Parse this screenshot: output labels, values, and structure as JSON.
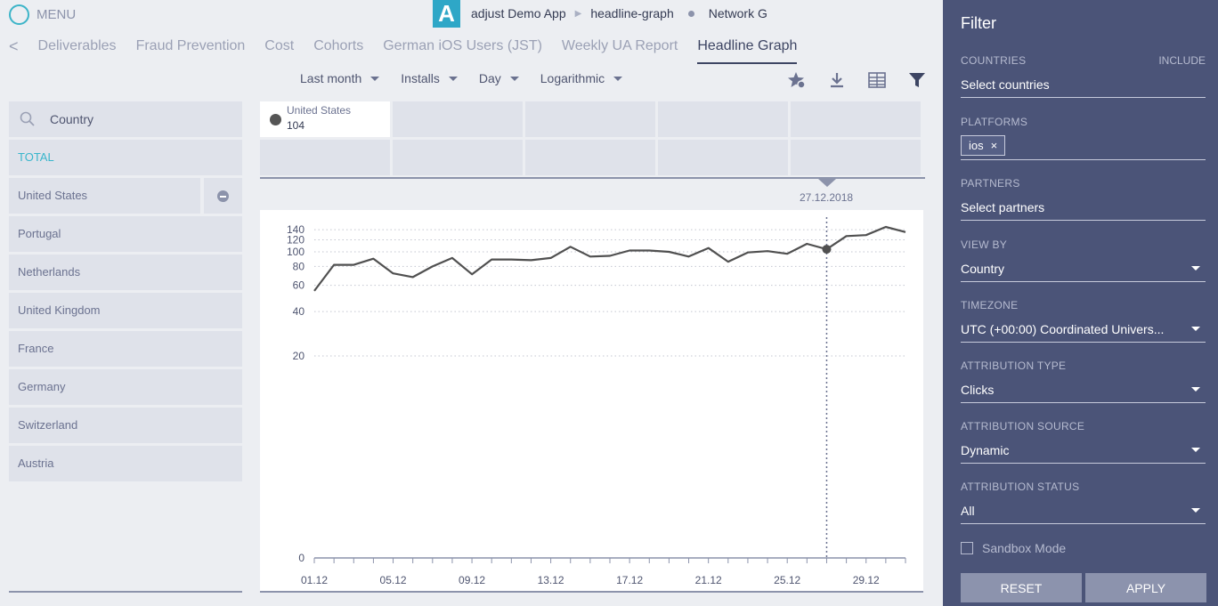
{
  "header": {
    "menu_label": "MENU",
    "app_name": "adjust Demo App",
    "breadcrumb_1": "headline-graph",
    "breadcrumb_2": "Network G",
    "app_logo_letter": "A"
  },
  "tabs": [
    "Deliverables",
    "Fraud Prevention",
    "Cost",
    "Cohorts",
    "German iOS Users (JST)",
    "Weekly UA Report",
    "Headline Graph"
  ],
  "active_tab": "Headline Graph",
  "toolbar": {
    "period": "Last month",
    "metric": "Installs",
    "granularity": "Day",
    "scale": "Logarithmic",
    "icons": [
      "favorite-icon",
      "download-icon",
      "table-icon",
      "filter-icon"
    ]
  },
  "left_panel": {
    "search_placeholder": "Country",
    "total_label": "TOTAL",
    "countries": [
      "United States",
      "Portugal",
      "Netherlands",
      "United Kingdom",
      "France",
      "Germany",
      "Switzerland",
      "Austria"
    ]
  },
  "legend": {
    "selected_name": "United States",
    "selected_value": "104",
    "hover_date": "27.12.2018"
  },
  "chart_data": {
    "type": "line",
    "scale": "log",
    "y_ticks": [
      0,
      20,
      40,
      60,
      80,
      100,
      120,
      140
    ],
    "x_tick_labels": [
      "01.12",
      "05.12",
      "09.12",
      "13.12",
      "17.12",
      "21.12",
      "25.12",
      "29.12"
    ],
    "series": [
      {
        "name": "United States",
        "color": "#505050",
        "values": [
          55,
          82,
          82,
          90,
          72,
          68,
          80,
          91,
          71,
          89,
          89,
          88,
          91,
          108,
          93,
          94,
          102,
          102,
          100,
          93,
          106,
          86,
          99,
          101,
          97,
          113,
          104,
          127,
          129,
          146,
          135
        ]
      }
    ],
    "highlight_index": 26
  },
  "filter": {
    "title": "Filter",
    "countries_label": "COUNTRIES",
    "include_label": "INCLUDE",
    "countries_placeholder": "Select countries",
    "platforms_label": "PLATFORMS",
    "platform_chip": "ios",
    "chip_remove": "×",
    "partners_label": "PARTNERS",
    "partners_placeholder": "Select partners",
    "view_by_label": "VIEW BY",
    "view_by_value": "Country",
    "timezone_label": "TIMEZONE",
    "timezone_value": "UTC (+00:00) Coordinated Univers...",
    "attr_type_label": "ATTRIBUTION TYPE",
    "attr_type_value": "Clicks",
    "attr_source_label": "ATTRIBUTION SOURCE",
    "attr_source_value": "Dynamic",
    "attr_status_label": "ATTRIBUTION STATUS",
    "attr_status_value": "All",
    "sandbox_label": "Sandbox Mode",
    "reset_label": "RESET",
    "apply_label": "APPLY"
  },
  "colors": {
    "accent": "#39b6cc",
    "sidebar": "#4b5478",
    "line": "#505050"
  }
}
